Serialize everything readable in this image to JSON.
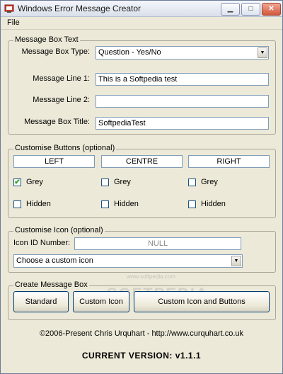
{
  "window": {
    "title": "Windows Error Message Creator",
    "min": "▁",
    "max": "□",
    "close": "✕"
  },
  "menu": {
    "file": "File"
  },
  "message_box_text": {
    "legend": "Message Box Text",
    "type_label": "Message Box Type:",
    "type_value": "Question - Yes/No",
    "line1_label": "Message Line 1:",
    "line1_value": "This is a Softpedia test",
    "line2_label": "Message Line 2:",
    "line2_value": "",
    "title_label": "Message Box Title:",
    "title_value": "SoftpediaTest"
  },
  "customise_buttons": {
    "legend": "Customise Buttons (optional)",
    "left": "LEFT",
    "centre": "CENTRE",
    "right": "RIGHT",
    "grey_label": "Grey",
    "hidden_label": "Hidden",
    "grey_left_checked": "✔",
    "grey_centre_checked": "",
    "grey_right_checked": ""
  },
  "customise_icon": {
    "legend": "Customise Icon (optional)",
    "id_label": "Icon ID Number:",
    "id_value": "NULL",
    "custom_icon_value": "Choose a custom icon"
  },
  "create": {
    "legend": "Create Message Box",
    "standard": "Standard",
    "custom_icon": "Custom Icon",
    "custom_icon_buttons": "Custom Icon and Buttons"
  },
  "footer": {
    "copyright": "©2006-Present Chris Urquhart - http://www.curquhart.co.uk",
    "version": "CURRENT VERSION: v1.1.1"
  },
  "watermark": {
    "text": "SOFTPEDIA",
    "url": "www.softpedia.com"
  }
}
